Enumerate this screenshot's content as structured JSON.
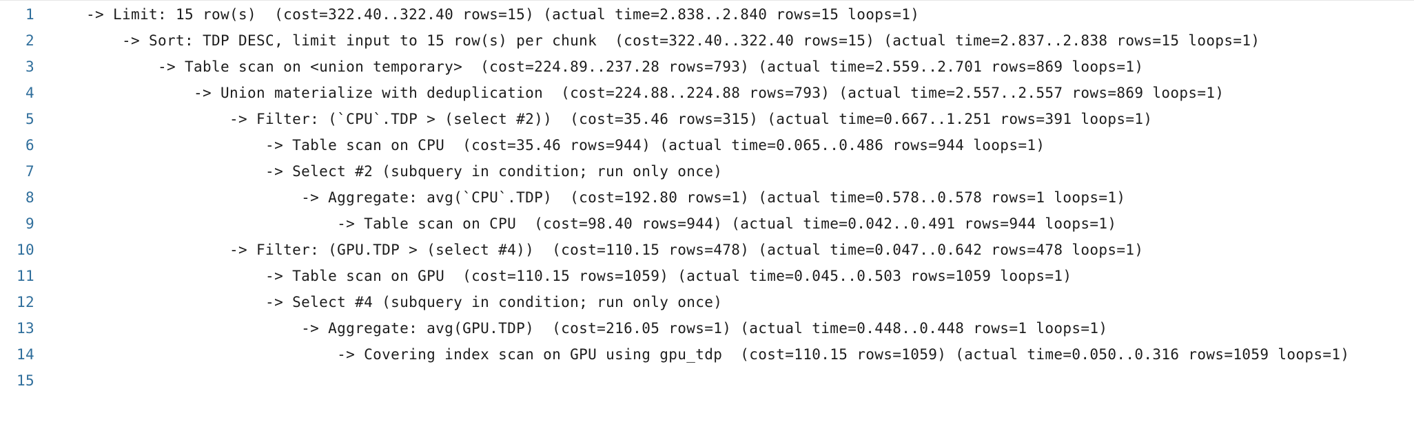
{
  "editor": {
    "lines": [
      {
        "number": "1",
        "text": "-> Limit: 15 row(s)  (cost=322.40..322.40 rows=15) (actual time=2.838..2.840 rows=15 loops=1)"
      },
      {
        "number": "2",
        "text": "    -> Sort: TDP DESC, limit input to 15 row(s) per chunk  (cost=322.40..322.40 rows=15) (actual time=2.837..2.838 rows=15 loops=1)"
      },
      {
        "number": "3",
        "text": "        -> Table scan on <union temporary>  (cost=224.89..237.28 rows=793) (actual time=2.559..2.701 rows=869 loops=1)"
      },
      {
        "number": "4",
        "text": "            -> Union materialize with deduplication  (cost=224.88..224.88 rows=793) (actual time=2.557..2.557 rows=869 loops=1)"
      },
      {
        "number": "5",
        "text": "                -> Filter: (`CPU`.TDP > (select #2))  (cost=35.46 rows=315) (actual time=0.667..1.251 rows=391 loops=1)"
      },
      {
        "number": "6",
        "text": "                    -> Table scan on CPU  (cost=35.46 rows=944) (actual time=0.065..0.486 rows=944 loops=1)"
      },
      {
        "number": "7",
        "text": "                    -> Select #2 (subquery in condition; run only once)"
      },
      {
        "number": "8",
        "text": "                        -> Aggregate: avg(`CPU`.TDP)  (cost=192.80 rows=1) (actual time=0.578..0.578 rows=1 loops=1)"
      },
      {
        "number": "9",
        "text": "                            -> Table scan on CPU  (cost=98.40 rows=944) (actual time=0.042..0.491 rows=944 loops=1)"
      },
      {
        "number": "10",
        "text": "                -> Filter: (GPU.TDP > (select #4))  (cost=110.15 rows=478) (actual time=0.047..0.642 rows=478 loops=1)"
      },
      {
        "number": "11",
        "text": "                    -> Table scan on GPU  (cost=110.15 rows=1059) (actual time=0.045..0.503 rows=1059 loops=1)"
      },
      {
        "number": "12",
        "text": "                    -> Select #4 (subquery in condition; run only once)"
      },
      {
        "number": "13",
        "text": "                        -> Aggregate: avg(GPU.TDP)  (cost=216.05 rows=1) (actual time=0.448..0.448 rows=1 loops=1)"
      },
      {
        "number": "14",
        "text": "                            -> Covering index scan on GPU using gpu_tdp  (cost=110.15 rows=1059) (actual time=0.050..0.316 rows=1059 loops=1)"
      },
      {
        "number": "15",
        "text": ""
      }
    ]
  },
  "colors": {
    "line_number": "#2f6e9b",
    "code_text": "#1c1c1c",
    "background": "#ffffff"
  }
}
